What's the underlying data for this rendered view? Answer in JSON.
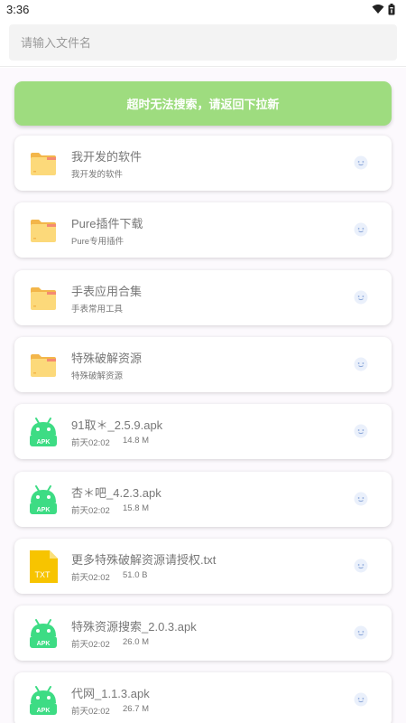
{
  "status": {
    "time": "3:36"
  },
  "search": {
    "placeholder": "请输入文件名"
  },
  "notice": {
    "text": "超时无法搜索，请返回下拉新"
  },
  "colors": {
    "notice_bg": "#9edc7f",
    "folder": "#fcd97a",
    "apk": "#3ddc84",
    "txt": "#f7c400"
  },
  "items": [
    {
      "icon": "folder-icon",
      "title": "我开发的软件",
      "subtitle": "我开发的软件"
    },
    {
      "icon": "folder-icon",
      "title": "Pure插件下载",
      "subtitle": "Pure专用插件"
    },
    {
      "icon": "folder-icon",
      "title": "手表应用合集",
      "subtitle": "手表常用工具"
    },
    {
      "icon": "folder-icon",
      "title": "特殊破解资源",
      "subtitle": "特殊破解资源"
    },
    {
      "icon": "apk-icon",
      "icon_label": "APK",
      "title": "91取＊_2.5.9.apk",
      "date": "前天02:02",
      "size": "14.8 M"
    },
    {
      "icon": "apk-icon",
      "icon_label": "APK",
      "title": "杏＊吧_4.2.3.apk",
      "date": "前天02:02",
      "size": "15.8 M"
    },
    {
      "icon": "txt-icon",
      "icon_label": "TXT",
      "title": "更多特殊破解资源请授权.txt",
      "date": "前天02:02",
      "size": "51.0 B"
    },
    {
      "icon": "apk-icon",
      "icon_label": "APK",
      "title": "特殊资源搜索_2.0.3.apk",
      "date": "前天02:02",
      "size": "26.0 M"
    },
    {
      "icon": "apk-icon",
      "icon_label": "APK",
      "title": "代网_1.1.3.apk",
      "date": "前天02:02",
      "size": "26.7 M"
    }
  ]
}
